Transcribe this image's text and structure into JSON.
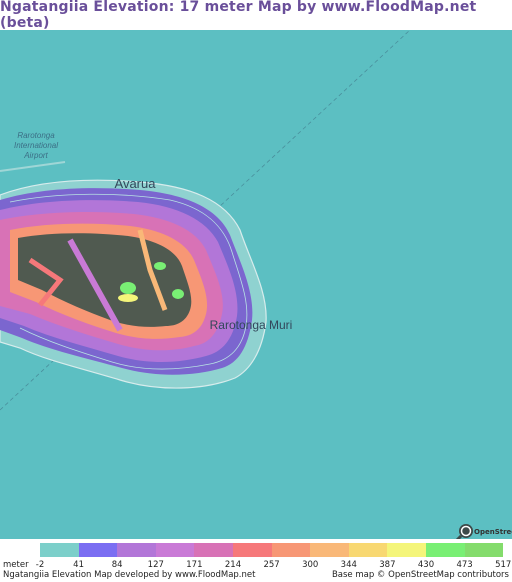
{
  "title": "Ngatangiia Elevation: 17 meter Map by www.FloodMap.net (beta)",
  "map": {
    "labels": {
      "airport_line1": "Rarotonga",
      "airport_line2": "International",
      "airport_line3": "Airport",
      "town_avarua": "Avarua",
      "town_muri": "Rarotonga Muri"
    },
    "colors": {
      "sea": "#5cbfc2",
      "reef": "#8fd2d0",
      "lowland": "#7b66cf",
      "highland": "#505a50",
      "peak": "#4fd94f"
    },
    "osm_badge": "OpenStreetMap"
  },
  "legend": {
    "unit_label": "meter",
    "ticks": [
      "-2",
      "41",
      "84",
      "127",
      "171",
      "214",
      "257",
      "300",
      "344",
      "387",
      "430",
      "473",
      "517"
    ],
    "colors": [
      "#7ccfca",
      "#7b6ef2",
      "#b276d8",
      "#c97ad6",
      "#d872b6",
      "#f6787a",
      "#f79775",
      "#f9b878",
      "#f8d872",
      "#f4f57a",
      "#79ef74",
      "#84dc6c"
    ]
  },
  "credits": {
    "left": "Ngatangiia Elevation Map developed by www.FloodMap.net",
    "right": "Base map © OpenStreetMap contributors"
  }
}
